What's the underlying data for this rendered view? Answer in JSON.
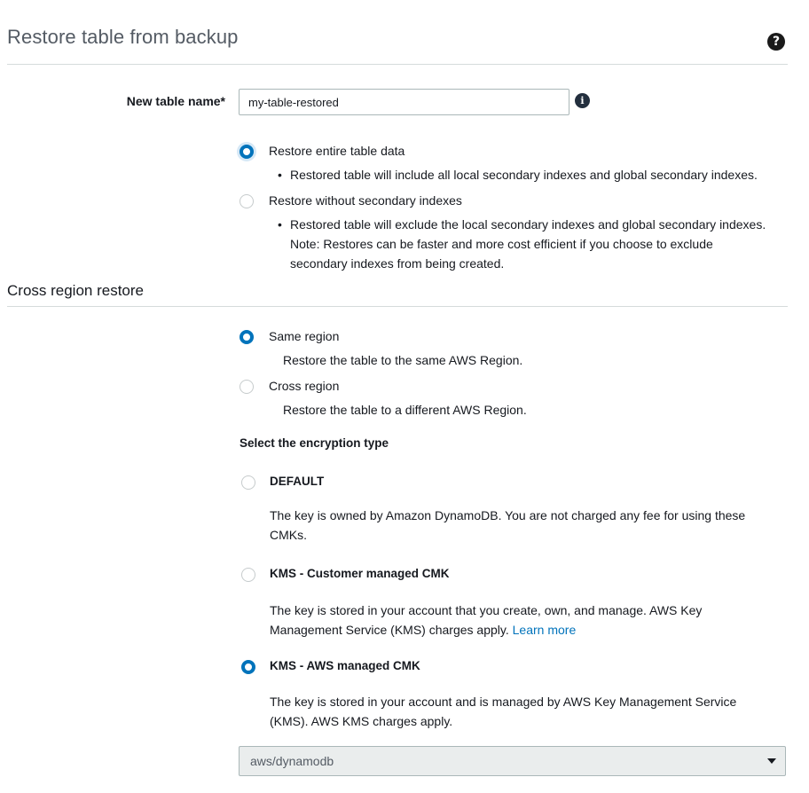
{
  "header": {
    "title": "Restore table from backup",
    "help_icon": "question-circle-icon"
  },
  "table_name": {
    "label": "New table name*",
    "value": "my-table-restored",
    "info_icon": "info-circle-icon"
  },
  "restore_options": [
    {
      "label": "Restore entire table data",
      "selected": true,
      "bullets": [
        "Restored table will include all local secondary indexes and global secondary indexes."
      ]
    },
    {
      "label": "Restore without secondary indexes",
      "selected": false,
      "bullets": [
        "Restored table will exclude the local secondary indexes and global secondary indexes. Note: Restores can be faster and more cost efficient if you choose to exclude secondary indexes from being created."
      ]
    }
  ],
  "cross_region": {
    "title": "Cross region restore",
    "options": [
      {
        "label": "Same region",
        "description": "Restore the table to the same AWS Region.",
        "selected": true
      },
      {
        "label": "Cross region",
        "description": "Restore the table to a different AWS Region.",
        "selected": false
      }
    ]
  },
  "encryption": {
    "heading": "Select the encryption type",
    "options": [
      {
        "label": "DEFAULT",
        "description": "The key is owned by Amazon DynamoDB. You are not charged any fee for using these CMKs.",
        "selected": false
      },
      {
        "label": "KMS - Customer managed CMK",
        "description": "The key is stored in your account that you create, own, and manage. AWS Key Management Service (KMS) charges apply.",
        "link": "Learn more",
        "selected": false
      },
      {
        "label": "KMS - AWS managed CMK",
        "description": "The key is stored in your account and is managed by AWS Key Management Service (KMS). AWS KMS charges apply.",
        "selected": true
      }
    ],
    "key_select": {
      "value": "aws/dynamodb",
      "icon": "caret-down-icon"
    }
  },
  "colors": {
    "accent": "#0073bb",
    "divider": "#d5dbdb",
    "title": "#545b64"
  }
}
